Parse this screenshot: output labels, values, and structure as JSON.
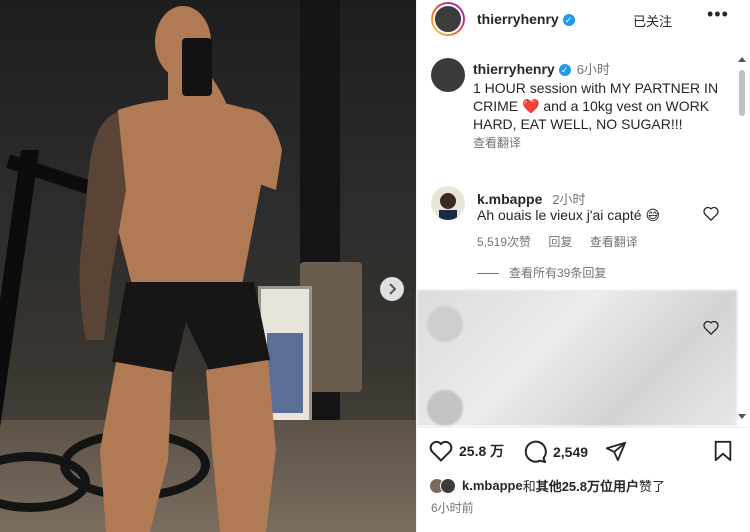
{
  "post": {
    "author": "thierryhenry",
    "follow_state": "已关注",
    "more_icon": "more-horizontal-icon"
  },
  "caption": {
    "author": "thierryhenry",
    "time": "6小时",
    "text_part1": "1 HOUR session with MY PARTNER IN CRIME",
    "emoji": "❤️",
    "text_part2": "and a 10kg vest on WORK HARD, EAT WELL, NO SUGAR!!!",
    "see_translation": "查看翻译"
  },
  "comments": [
    {
      "author": "k.mbappe",
      "time": "2小时",
      "text": "Ah ouais le vieux j'ai capté 😅",
      "likes": "5,519次赞",
      "reply": "回复",
      "see_translation": "查看翻译"
    }
  ],
  "view_all_replies": "查看所有39条回复",
  "actions": {
    "likes": "25.8 万",
    "comments": "2,549"
  },
  "liked_by": {
    "text_prefix": "k.mbappe",
    "text_connector": "和",
    "text_suffix": "其他25.8万位用户",
    "text_end": "赞了"
  },
  "post_time": "6小时前",
  "colors": {
    "verified": "#1d9bf0",
    "heart": "#ed1c24",
    "secondary_text": "#737373"
  }
}
